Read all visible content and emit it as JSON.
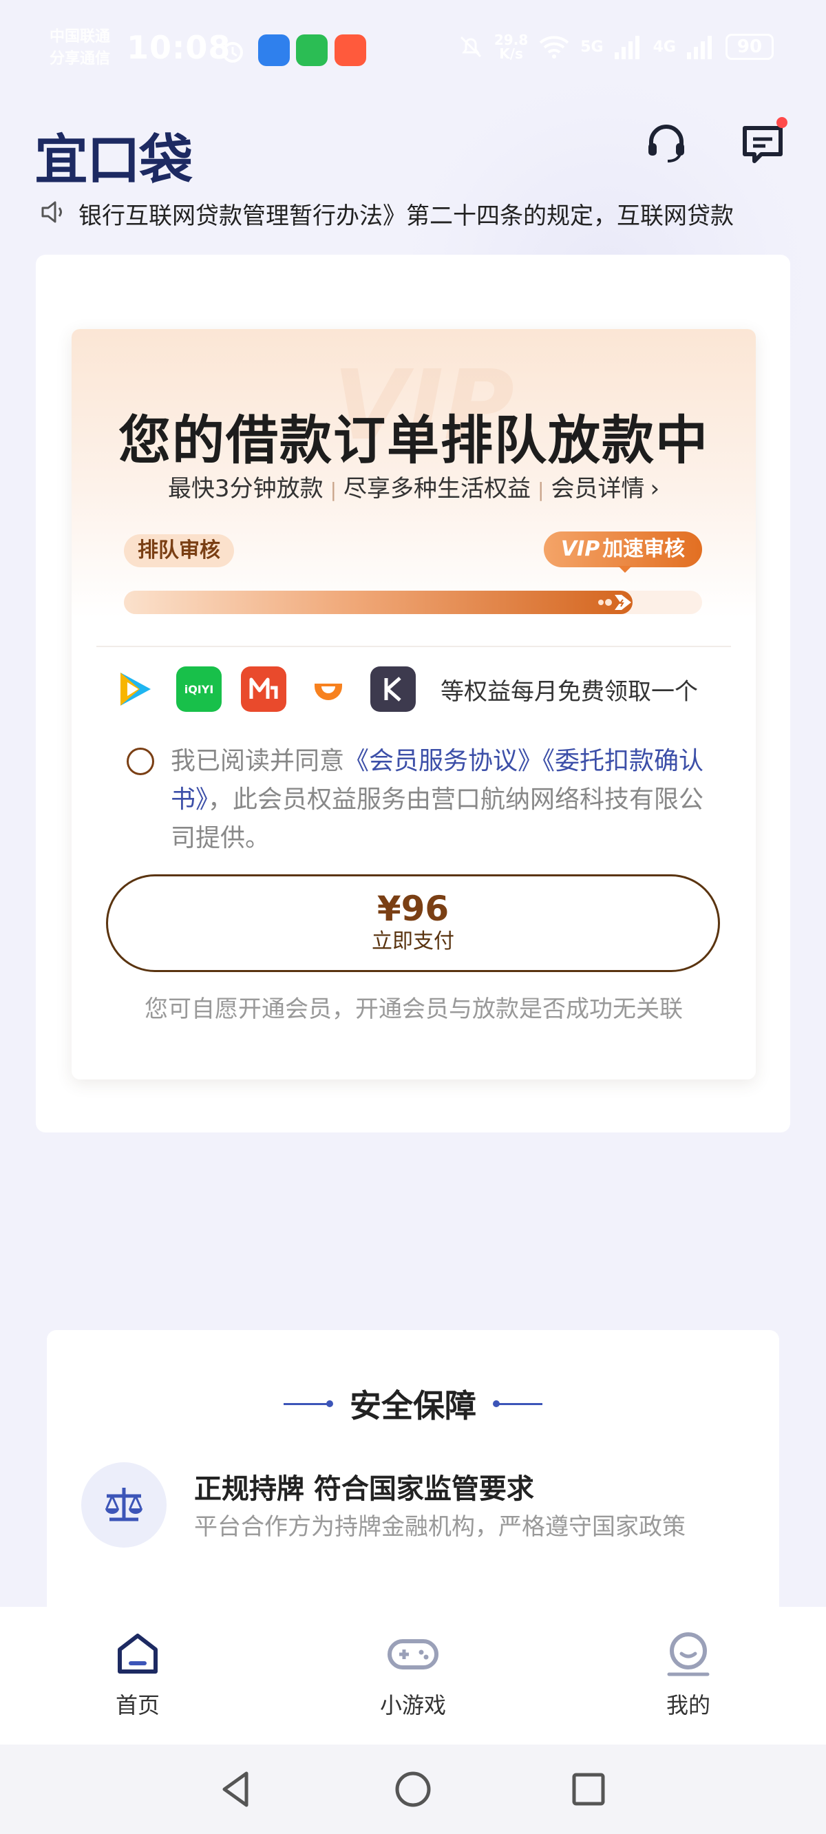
{
  "status_bar": {
    "carrier_line1": "中国联通",
    "carrier_line2": "分享通信",
    "time": "10:08",
    "net_speed_value": "29.8",
    "net_speed_unit": "K/s",
    "signal_1": "5G",
    "signal_2": "4G",
    "battery": "90",
    "icons": [
      "alarm-icon",
      "messages-app-icon",
      "wechat-app-icon",
      "kuaishou-app-icon",
      "mute-icon",
      "wifi-icon",
      "signal-icon"
    ]
  },
  "header": {
    "logo": "宜口袋",
    "icons": [
      "headset-support-icon",
      "message-icon"
    ]
  },
  "notice": {
    "text": "银行互联网贷款管理暂行办法》第二十四条的规定，互联网贷款"
  },
  "vip": {
    "watermark": "VIP",
    "title": "您的借款订单排队放款中",
    "benefit_1": "最快3分钟放款",
    "benefit_2": "尽享多种生活权益",
    "benefit_3": "会员详情",
    "separator": "|",
    "queue_label": "排队审核",
    "fast_badge_vip": "VIP",
    "fast_label": "加速审核",
    "progress": 0.88,
    "partner_apps": [
      "tencent-video-icon",
      "iqiyi-icon",
      "mgtv-icon",
      "didi-icon",
      "keep-icon"
    ],
    "iqiyi_text": "iQIYI",
    "apps_text": "等权益每月免费领取一个",
    "agree_prefix": "我已阅读并同意",
    "agree_link_1": "《会员服务协议》",
    "agree_link_2": "《委托扣款确认书》",
    "agree_suffix": "，此会员权益服务由营口航纳网络科技有限公司提供。",
    "pay_price": "¥96",
    "pay_label": "立即支付",
    "disclaimer": "您可自愿开通会员，开通会员与放款是否成功无关联"
  },
  "security": {
    "title": "安全保障",
    "item_title": "正规持牌 符合国家监管要求",
    "item_desc": "平台合作方为持牌金融机构，严格遵守国家政策"
  },
  "tabbar": {
    "tabs": [
      {
        "label": "首页",
        "icon": "home-icon"
      },
      {
        "label": "小游戏",
        "icon": "gamepad-icon"
      },
      {
        "label": "我的",
        "icon": "profile-icon"
      }
    ]
  },
  "colors": {
    "brand_navy": "#1d2a62",
    "vip_orange": "#e26f22",
    "link_blue": "#3c4fa8",
    "pay_brown": "#7a3f14"
  }
}
